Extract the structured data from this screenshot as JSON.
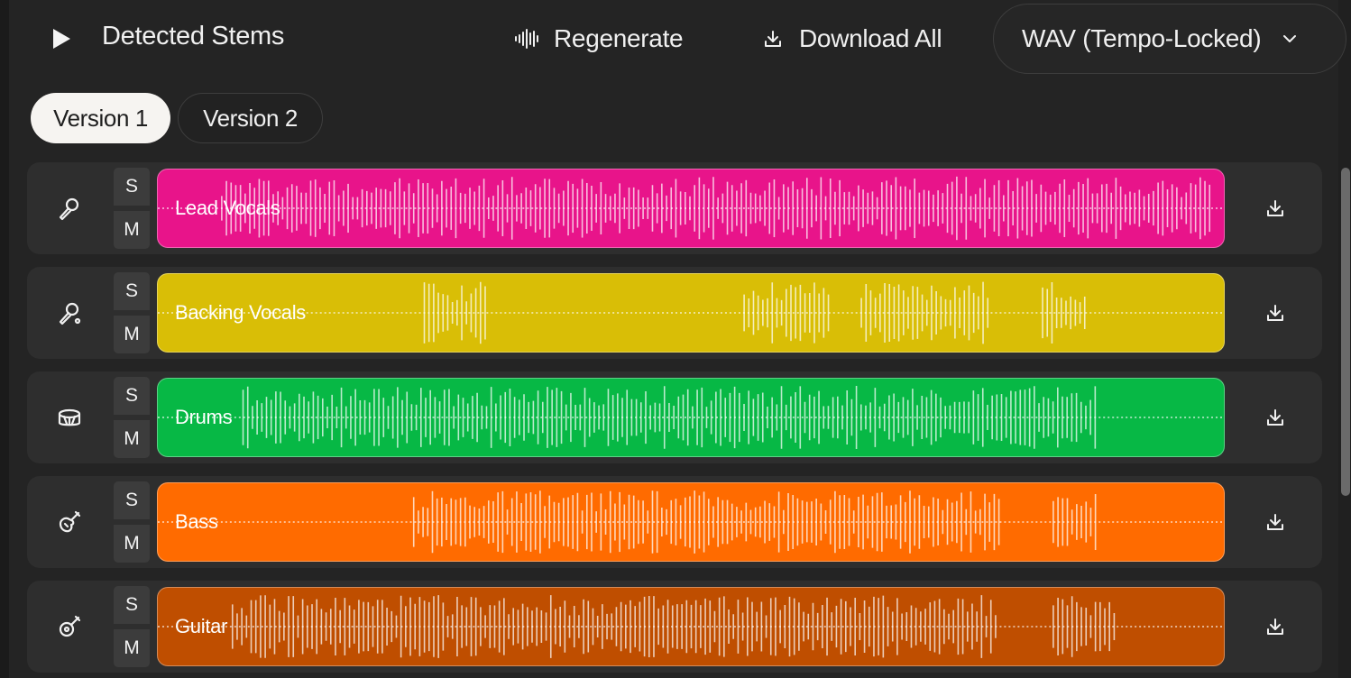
{
  "header": {
    "title": "Detected Stems",
    "regenerate_label": "Regenerate",
    "download_all_label": "Download All",
    "format_selected": "WAV (Tempo-Locked)"
  },
  "tabs": [
    {
      "label": "Version 1",
      "active": true
    },
    {
      "label": "Version 2",
      "active": false
    }
  ],
  "solo_label": "S",
  "mute_label": "M",
  "stems": [
    {
      "name": "Lead Vocals",
      "color": "#e8148a",
      "icon": "microphone-icon",
      "activity": [
        [
          0.06,
          0.99
        ]
      ]
    },
    {
      "name": "Backing Vocals",
      "color": "#d9be06",
      "icon": "microphone-alt-icon",
      "activity": [
        [
          0.25,
          0.31
        ],
        [
          0.55,
          0.63
        ],
        [
          0.66,
          0.78
        ],
        [
          0.83,
          0.87
        ]
      ]
    },
    {
      "name": "Drums",
      "color": "#07b845",
      "icon": "drum-icon",
      "activity": [
        [
          0.08,
          0.88
        ]
      ]
    },
    {
      "name": "Bass",
      "color": "#ff6b00",
      "icon": "electric-guitar-icon",
      "activity": [
        [
          0.24,
          0.79
        ],
        [
          0.84,
          0.88
        ]
      ]
    },
    {
      "name": "Guitar",
      "color": "#bf4e00",
      "icon": "acoustic-guitar-icon",
      "activity": [
        [
          0.07,
          0.79
        ],
        [
          0.84,
          0.9
        ]
      ]
    }
  ]
}
